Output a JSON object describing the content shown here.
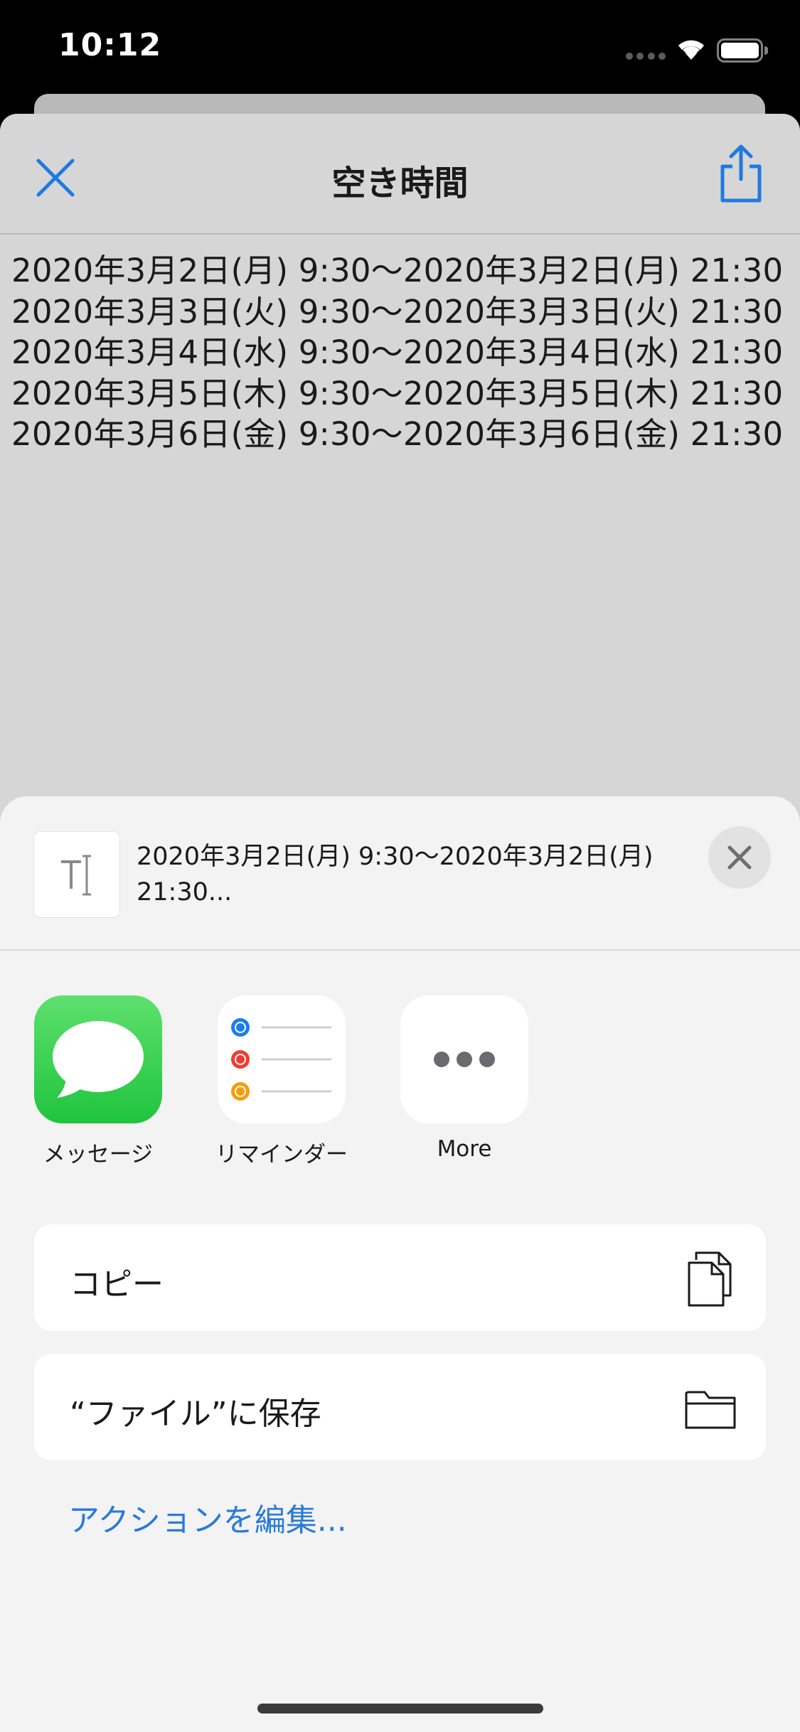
{
  "status_bar": {
    "time": "10:12"
  },
  "nav": {
    "title": "空き時間"
  },
  "schedule": {
    "lines": [
      "2020年3月2日(月) 9:30〜2020年3月2日(月) 21:30",
      "2020年3月3日(火) 9:30〜2020年3月3日(火) 21:30",
      "2020年3月4日(水) 9:30〜2020年3月4日(水) 21:30",
      "2020年3月5日(木) 9:30〜2020年3月5日(木) 21:30",
      "2020年3月6日(金) 9:30〜2020年3月6日(金) 21:30"
    ]
  },
  "share_sheet": {
    "preview_text": "2020年3月2日(月) 9:30〜2020年3月2日(月) 21:30...",
    "apps": [
      {
        "label": "メッセージ",
        "icon": "messages-icon"
      },
      {
        "label": "リマインダー",
        "icon": "reminders-icon"
      },
      {
        "label": "More",
        "icon": "more-icon"
      }
    ],
    "actions": [
      {
        "label": "コピー",
        "icon": "copy-icon"
      },
      {
        "label": "“ファイル”に保存",
        "icon": "folder-icon"
      }
    ],
    "edit_actions": "アクションを編集..."
  },
  "colors": {
    "accent": "#1f7ae0",
    "messages_green": "#34c759",
    "reminders_blue": "#1a7cf0",
    "reminders_red": "#f23b30",
    "reminders_orange": "#f59d0b"
  }
}
